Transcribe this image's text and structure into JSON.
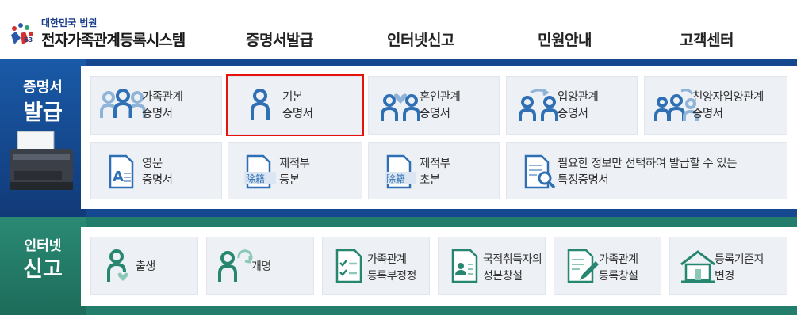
{
  "header": {
    "logo_small": "대한민국 법원",
    "logo_big": "전자가족관계등록시스템",
    "nav": [
      "증명서발급",
      "인터넷신고",
      "민원안내",
      "고객센터"
    ]
  },
  "issue_section": {
    "title_top": "증명서",
    "title_bottom": "발급",
    "cards": [
      {
        "line1": "가족관계",
        "line2": "증명서",
        "icon": "family-people-icon"
      },
      {
        "line1": "기본",
        "line2": "증명서",
        "icon": "person-icon"
      },
      {
        "line1": "혼인관계",
        "line2": "증명서",
        "icon": "couple-heart-icon"
      },
      {
        "line1": "입양관계",
        "line2": "증명서",
        "icon": "adoption-icon"
      },
      {
        "line1": "친양자입양관계",
        "line2": "증명서",
        "icon": "family-adoption-icon"
      },
      {
        "line1": "영문",
        "line2": "증명서",
        "icon": "document-a-icon"
      },
      {
        "line1": "제적부",
        "line2": "등본",
        "icon": "document-hanja-icon",
        "badge": "除籍"
      },
      {
        "line1": "제적부",
        "line2": "초본",
        "icon": "document-hanja-icon",
        "badge": "除籍"
      },
      {
        "line1": "필요한 정보만 선택하여 발급할 수 있는",
        "line2": "특정증명서",
        "icon": "document-search-icon"
      }
    ]
  },
  "report_section": {
    "title_top": "인터넷",
    "title_bottom": "신고",
    "cards": [
      {
        "line1": "출생",
        "line2": "",
        "icon": "birth-icon"
      },
      {
        "line1": "개명",
        "line2": "",
        "icon": "rename-icon"
      },
      {
        "line1": "가족관계",
        "line2": "등록부정정",
        "icon": "checklist-icon"
      },
      {
        "line1": "국적취득자의",
        "line2": "성본창설",
        "icon": "id-card-icon"
      },
      {
        "line1": "가족관계",
        "line2": "등록창설",
        "icon": "document-pen-icon"
      },
      {
        "line1": "등록기준지",
        "line2": "변경",
        "icon": "house-icon"
      }
    ]
  },
  "colors": {
    "blue_band": "#15488f",
    "green_band": "#227e6a",
    "icon_blue": "#2f6fb4",
    "selected_outline": "#e8120c"
  }
}
